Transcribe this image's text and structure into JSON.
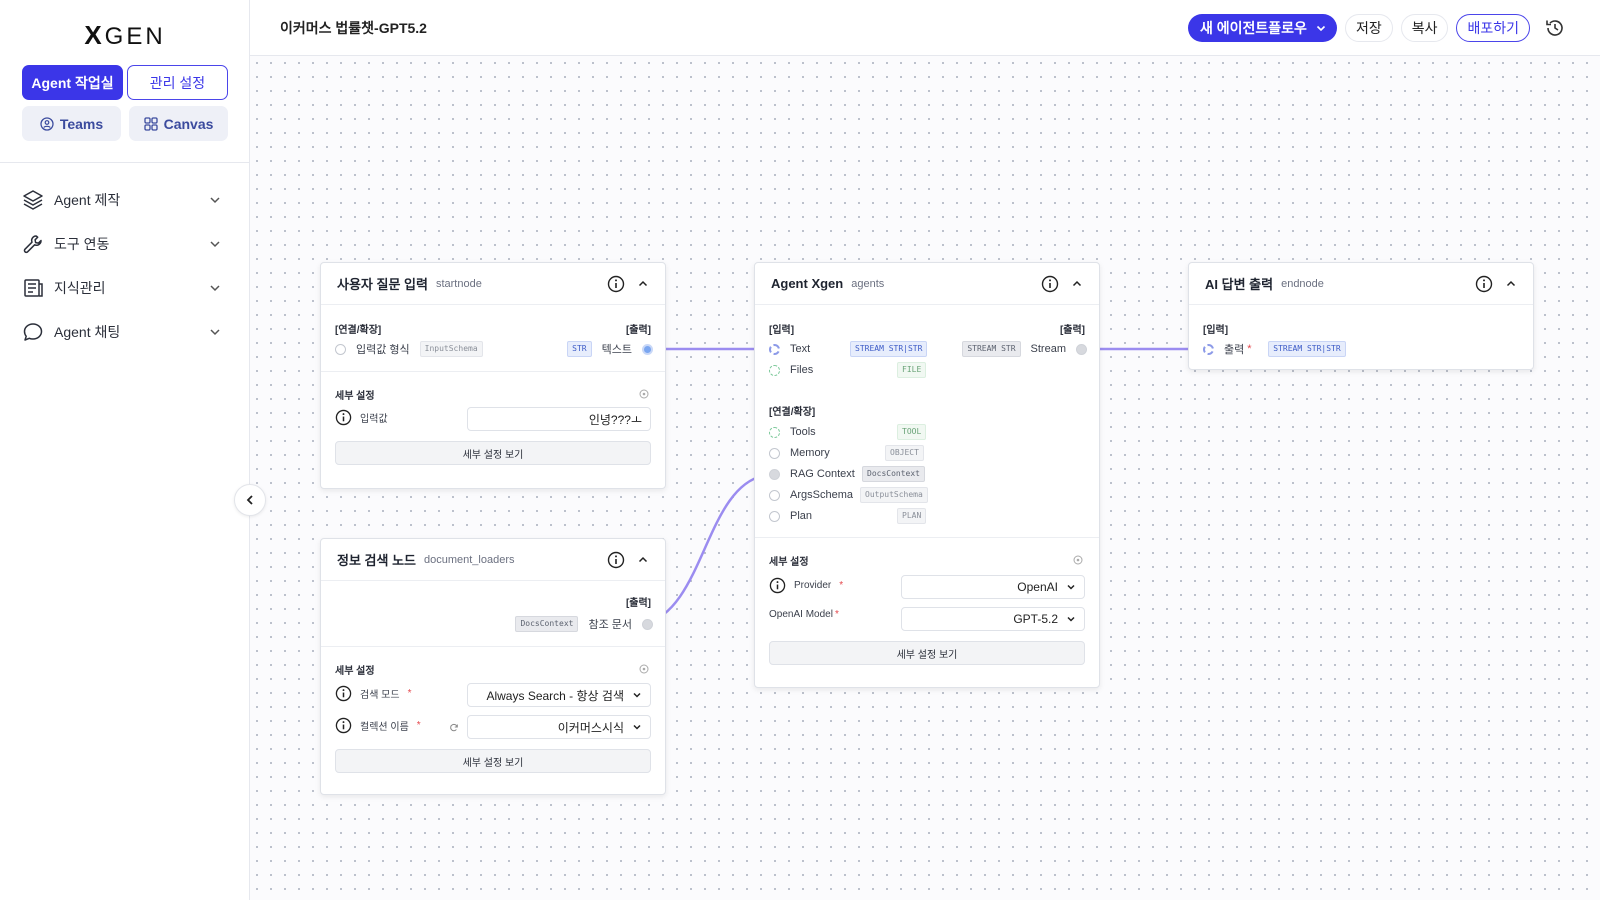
{
  "app": {
    "logo_mark": "X",
    "logo_text": "GEN"
  },
  "sidebar": {
    "primary_tabs": [
      {
        "label": "Agent 작업실"
      },
      {
        "label": "관리 설정"
      }
    ],
    "secondary_tabs": [
      {
        "label": "Teams"
      },
      {
        "label": "Canvas"
      }
    ],
    "menu": [
      {
        "label": "Agent 제작",
        "icon": "layers-icon"
      },
      {
        "label": "도구 연동",
        "icon": "wrench-icon"
      },
      {
        "label": "지식관리",
        "icon": "document-icon"
      },
      {
        "label": "Agent 채팅",
        "icon": "chat-bubble-icon"
      }
    ]
  },
  "topbar": {
    "workflow_title": "이커머스 법률챗-GPT5.2",
    "new_workflow": "새 에이전트플로우",
    "save": "저장",
    "copy": "복사",
    "deploy": "배포하기"
  },
  "nodes": {
    "start": {
      "title": "사용자 질문 입력",
      "type": "startnode",
      "section_connect": "[연결/확장]",
      "section_output": "[출력]",
      "input_label": "입력값 형식",
      "input_tag": "InputSchema",
      "output_tag": "STR",
      "output_label": "텍스트",
      "detail_title": "세부 설정",
      "field_label": "입력값",
      "field_value": "인녕???ㅗ",
      "detail_button": "세부 설정 보기"
    },
    "search": {
      "title": "정보 검색 노드",
      "type": "document_loaders",
      "section_output": "[출력]",
      "output_tag": "DocsContext",
      "output_label": "참조 문서",
      "detail_title": "세부 설정",
      "mode_label": "검색 모드",
      "mode_value": "Always Search - 항상 검색",
      "collection_label": "컬렉션 이름",
      "collection_value": "이커머스시식",
      "detail_button": "세부 설정 보기"
    },
    "agent": {
      "title": "Agent Xgen",
      "type": "agents",
      "section_input": "[입력]",
      "section_output": "[출력]",
      "inputs": [
        {
          "label": "Text",
          "tag": "STREAM STR|STR"
        },
        {
          "label": "Files",
          "tag": "FILE"
        }
      ],
      "output_tag": "STREAM STR",
      "output_label": "Stream",
      "section_connect": "[연결/확장]",
      "connects": [
        {
          "label": "Tools",
          "tag": "TOOL"
        },
        {
          "label": "Memory",
          "tag": "OBJECT"
        },
        {
          "label": "RAG Context",
          "tag": "DocsContext"
        },
        {
          "label": "ArgsSchema",
          "tag": "OutputSchema"
        },
        {
          "label": "Plan",
          "tag": "PLAN"
        }
      ],
      "detail_title": "세부 설정",
      "provider_label": "Provider",
      "provider_value": "OpenAI",
      "model_label": "OpenAI Model",
      "model_value": "GPT-5.2",
      "detail_button": "세부 설정 보기"
    },
    "end": {
      "title": "AI 답변 출력",
      "type": "endnode",
      "section_input": "[입력]",
      "input_label": "출력",
      "input_tag": "STREAM STR|STR"
    }
  },
  "colors": {
    "accent": "#3b36e8",
    "edge": "#9b8cf0"
  }
}
